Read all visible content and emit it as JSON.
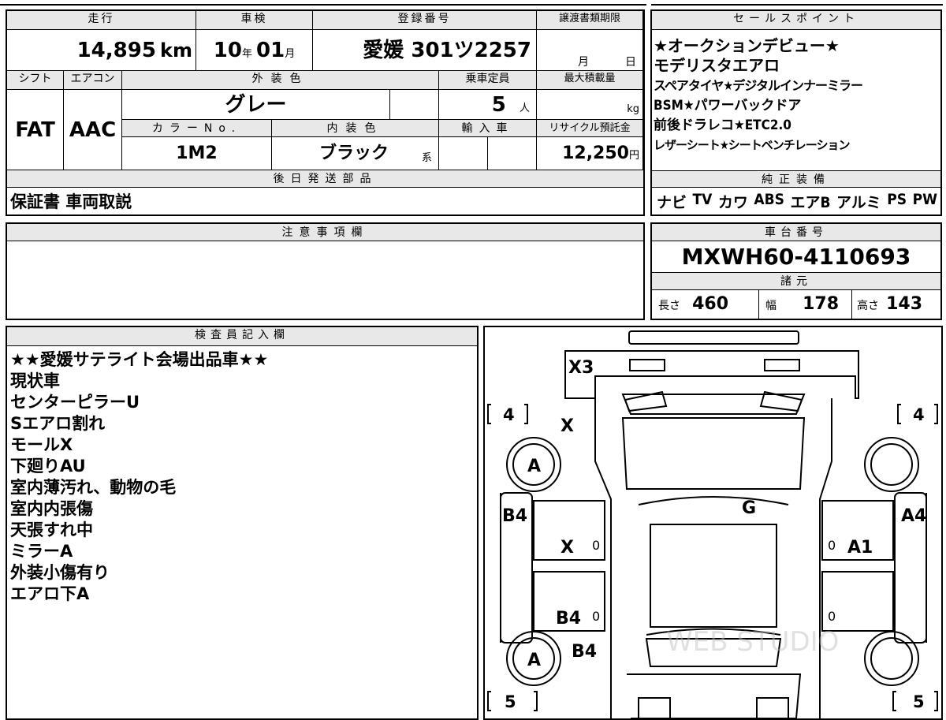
{
  "top_header": {
    "mileage_label": "走行",
    "inspection_label": "車検",
    "registration_label": "登録番号",
    "transfer_label": "譲渡書類期限"
  },
  "mileage": {
    "value": "14,895",
    "unit": "km"
  },
  "inspection": {
    "year": "10",
    "year_unit": "年",
    "month": "01",
    "month_unit": "月"
  },
  "registration": {
    "value": "愛媛 301ツ2257"
  },
  "transfer": {
    "month_unit": "月",
    "day_unit": "日"
  },
  "row2_header": {
    "shift_label": "シフト",
    "aircon_label": "エアコン",
    "exterior_color_label": "外装色",
    "capacity_label": "乗車定員",
    "max_load_label": "最大積載量"
  },
  "shift": {
    "value": "FAT"
  },
  "aircon": {
    "value": "AAC"
  },
  "exterior_color": {
    "value": "グレー"
  },
  "capacity": {
    "value": "5",
    "unit": "人"
  },
  "max_load": {
    "unit": "kg"
  },
  "row3_header": {
    "color_no_label": "カラーNo.",
    "interior_color_label": "内装色",
    "import_label": "輸入車",
    "recycle_label": "リサイクル預託金"
  },
  "color_no": {
    "value": "1M2"
  },
  "interior_color": {
    "value": "ブラック",
    "suffix": "系"
  },
  "recycle": {
    "value": "12,250",
    "unit": "円"
  },
  "delivery": {
    "label": "後日発送部品",
    "value": "保証書 車両取説"
  },
  "sales_points": {
    "label": "セールスポイント",
    "lines": [
      "★オークションデビュー★",
      "モデリスタエアロ",
      "スペアタイヤ★デジタルインナーミラー",
      "BSM★パワーバックドア",
      "前後ドラレコ★ETC2.0",
      "レザーシート★シートベンチレーション"
    ]
  },
  "equipment": {
    "label": "純正装備",
    "items": [
      "ナビ",
      "TV",
      "カワ",
      "ABS",
      "エアB",
      "アルミ",
      "PS",
      "PW"
    ]
  },
  "notes": {
    "label": "注意事項欄"
  },
  "chassis": {
    "label": "車台番号",
    "value": "MXWH60-4110693"
  },
  "specs": {
    "label": "諸元",
    "length_label": "長さ",
    "length": "460",
    "width_label": "幅",
    "width": "178",
    "height_label": "高さ",
    "height": "143"
  },
  "inspector": {
    "label": "検査員記入欄",
    "lines": [
      "★★愛媛サテライト会場出品車★★",
      "現状車",
      "センターピラーU",
      "Sエアロ割れ",
      "モールX",
      "下廻りAU",
      "室内薄汚れ、動物の毛",
      "室内内張傷",
      "天張すれ中",
      "ミラーA",
      "外装小傷有り",
      "エアロ下A"
    ]
  },
  "diagram": {
    "marks": {
      "rear": "X3",
      "front_left_upper": "X",
      "tire_fl": "A",
      "roof": "G",
      "left_front_door_panel": "B4",
      "right_front_door_panel": "A4",
      "left_front_door": "X",
      "right_front_door": "A1",
      "left_rear_door": "B4",
      "left_rear_lower": "B4",
      "tire_rl": "A"
    },
    "tire_depth": {
      "front_left": "4",
      "front_right": "4",
      "rear_left": "5",
      "rear_right": "5"
    },
    "zero_marks": [
      "0",
      "0",
      "0",
      "0"
    ],
    "watermark": "WEB STUDIO"
  }
}
